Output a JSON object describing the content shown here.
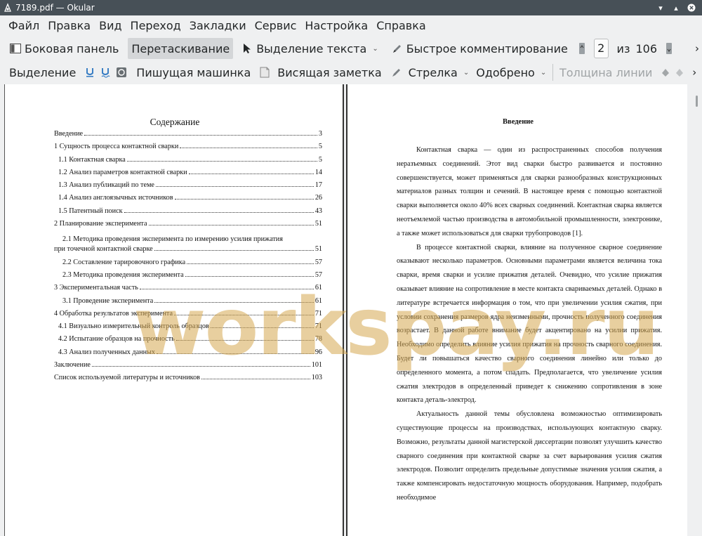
{
  "window": {
    "title": "7189.pdf  — Okular"
  },
  "menubar": [
    "Файл",
    "Правка",
    "Вид",
    "Переход",
    "Закладки",
    "Сервис",
    "Настройка",
    "Справка"
  ],
  "toolbar1": {
    "sidebar": "Боковая панель",
    "browse": "Перетаскивание",
    "text_select": "Выделение текста",
    "quick_annot": "Быстрое комментирование",
    "page_current": "2",
    "page_of": "из",
    "page_total": "106"
  },
  "toolbar2": {
    "selection": "Выделение",
    "typewriter": "Пишущая машинка",
    "inline_note": "Висящая заметка",
    "arrow": "Стрелка",
    "approved": "Одобрено",
    "line_width": "Толщина линии"
  },
  "toc": {
    "title": "Содержание",
    "entries": [
      {
        "t": "Введение",
        "p": "3"
      },
      {
        "t": "1 Сущность процесса контактной сварки",
        "p": "5"
      },
      {
        "t": "1.1 Контактная сварка",
        "p": "5"
      },
      {
        "t": "1.2 Анализ параметров контактной сварки",
        "p": "14"
      },
      {
        "t": "1.3 Анализ публикаций по теме",
        "p": "17"
      },
      {
        "t": "1.4 Анализ англоязычных источников",
        "p": "26"
      },
      {
        "t": "1.5 Патентный поиск",
        "p": "43"
      },
      {
        "t": "2 Планирование эксперимента",
        "p": "51"
      },
      {
        "t": "2.1 Методика проведения эксперимента по измерению усилия прижатия",
        "p": ""
      },
      {
        "t": "при точечной контактной сварке",
        "p": "51"
      },
      {
        "t": "2.2 Составление тарировочного графика",
        "p": "57"
      },
      {
        "t": "2.3 Методика проведения эксперимента",
        "p": "57"
      },
      {
        "t": "3 Экспериментальная часть",
        "p": "61"
      },
      {
        "t": "3.1 Проведение эксперимента",
        "p": "61"
      },
      {
        "t": "4 Обработка результатов эксперимента",
        "p": "71"
      },
      {
        "t": "4.1 Визуально измерительный контроль образцов",
        "p": "71"
      },
      {
        "t": "4.2 Испытание образцов на прочность",
        "p": "78"
      },
      {
        "t": "4.3 Анализ полученных данных",
        "p": "96"
      },
      {
        "t": "Заключение",
        "p": "101"
      },
      {
        "t": "Список используемой литературы и источников",
        "p": "103"
      }
    ]
  },
  "intro": {
    "title": "Введение",
    "paragraphs": [
      "Контактная сварка — один из распространенных способов получения неразъемных соединений. Этот вид сварки быстро развивается и постоянно совершенствуется, может применяться для сварки разнообразных конструкционных материалов разных толщин и сечений. В настоящее время с помощью контактной сварки выполняется около 40% всех сварных соединений. Контактная сварка является неотъемлемой частью производства в автомобильной промышленности, электронике, а также может использоваться для сварки трубопроводов [1].",
      "В процессе контактной сварки, влияние на полученное сварное соединение оказывают несколько параметров. Основными параметрами является величина тока сварки, время сварки и усилие прижатия деталей. Очевидно, что усилие прижатия оказывает влияние на сопротивление в месте контакта свариваемых деталей. Однако в литературе встречается информация о том, что при увеличении усилия сжатия, при условии сохранения размеров ядра неизменными, прочность полученного соединения возрастает. В данной работе внимание будет акцентировано на усилии прижатия. Необходимо определить влияние усилия прижатия на прочность сварного соединения. Будет ли повышаться качество сварного соединения линейно или только до определенного момента, а потом спадать. Предполагается, что увеличение усилия сжатия электродов в определенный приведет к снижению сопротивления в зоне контакта деталь-электрод.",
      "Актуальность данной темы обусловлена возможностью оптимизировать существующие процессы на производствах, использующих контактную сварку. Возможно, результаты данной магистерской диссертации позволят улучшить качество сварного соединения при контактной сварке за счет варьирования усилия сжатия электродов. Позволит определить предельные допустимые значения усилия сжатия, а также компенсировать недостаточную мощность оборудования. Например, подобрать необходимое"
    ]
  },
  "watermark": "workspay.ru"
}
